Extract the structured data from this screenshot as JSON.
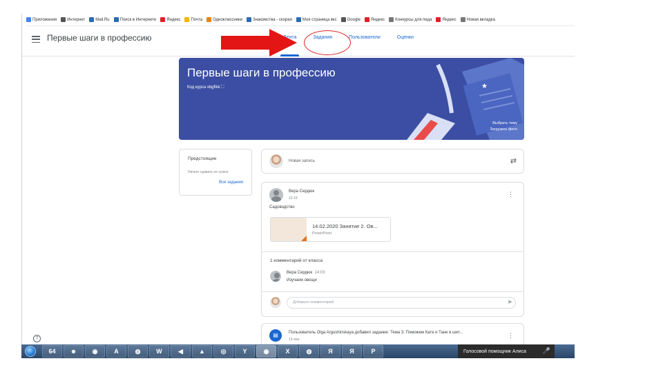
{
  "bookmarks": [
    {
      "label": "Приложения",
      "color": "#4285f4"
    },
    {
      "label": "Интернет",
      "color": "#555555"
    },
    {
      "label": "Mail.Ru",
      "color": "#2a6bb3"
    },
    {
      "label": "Поиск в Интернете",
      "color": "#2a6bb3"
    },
    {
      "label": "Яндекс",
      "color": "#e21f26"
    },
    {
      "label": "Почта",
      "color": "#f2b600"
    },
    {
      "label": "Одноклассники",
      "color": "#ee8208"
    },
    {
      "label": "Знакомства - скорая",
      "color": "#2a6bb3"
    },
    {
      "label": "Моя страница вкс",
      "color": "#2a6bb3"
    },
    {
      "label": "Google",
      "color": "#555555"
    },
    {
      "label": "Яндекс",
      "color": "#e21f26"
    },
    {
      "label": "Конкурсы для педа",
      "color": "#777777"
    },
    {
      "label": "Яндекс",
      "color": "#e21f26"
    },
    {
      "label": "Новая вкладка",
      "color": "#777777"
    }
  ],
  "header": {
    "course_title": "Первые шаги в профессию",
    "tabs": [
      "Лента",
      "Задания",
      "Пользователи",
      "Оценки"
    ],
    "active_tab": "Лента"
  },
  "banner": {
    "title": "Первые шаги в профессию",
    "course_code": "Код курса  xbgfikk  ⛶",
    "choose_theme": "Выбрать тему",
    "upload_photo": "Загрузить фото",
    "bg_color": "#3b4ea3"
  },
  "upcoming": {
    "title": "Предстоящие",
    "text": "Ничего сдавать не нужно",
    "link": "Все задания"
  },
  "new_post": {
    "placeholder": "Новая запись"
  },
  "post": {
    "author": "Вера Сердюк",
    "time": "13:19",
    "body": "Садоводство",
    "attachment_name": "14.02.2020 Занятие 2. Ов...",
    "attachment_type": "PowerPoint",
    "comments_title": "1 комментарий от класса",
    "comment_author": "Вера Сердюк",
    "comment_time": "14:03",
    "comment_text": "Изучаем овощи",
    "comment_placeholder": "Добавьте комментарий"
  },
  "notification": {
    "text": "Пользователь Olga Argushinskaya добавил задание: Тема 3. Поможем Кате и Тане в шит...",
    "date": "13 янв."
  },
  "taskbar": {
    "items": [
      "64",
      "☻",
      "◉",
      "A",
      "◍",
      "W",
      "◀",
      "▲",
      "◎",
      "Y",
      "◉",
      "X",
      "◍",
      "Я",
      "Я",
      "P"
    ],
    "assistant_label": "Голосовой помощник Алиса"
  },
  "accent_color": "#1967d2",
  "annotation_color": "#dd2222"
}
